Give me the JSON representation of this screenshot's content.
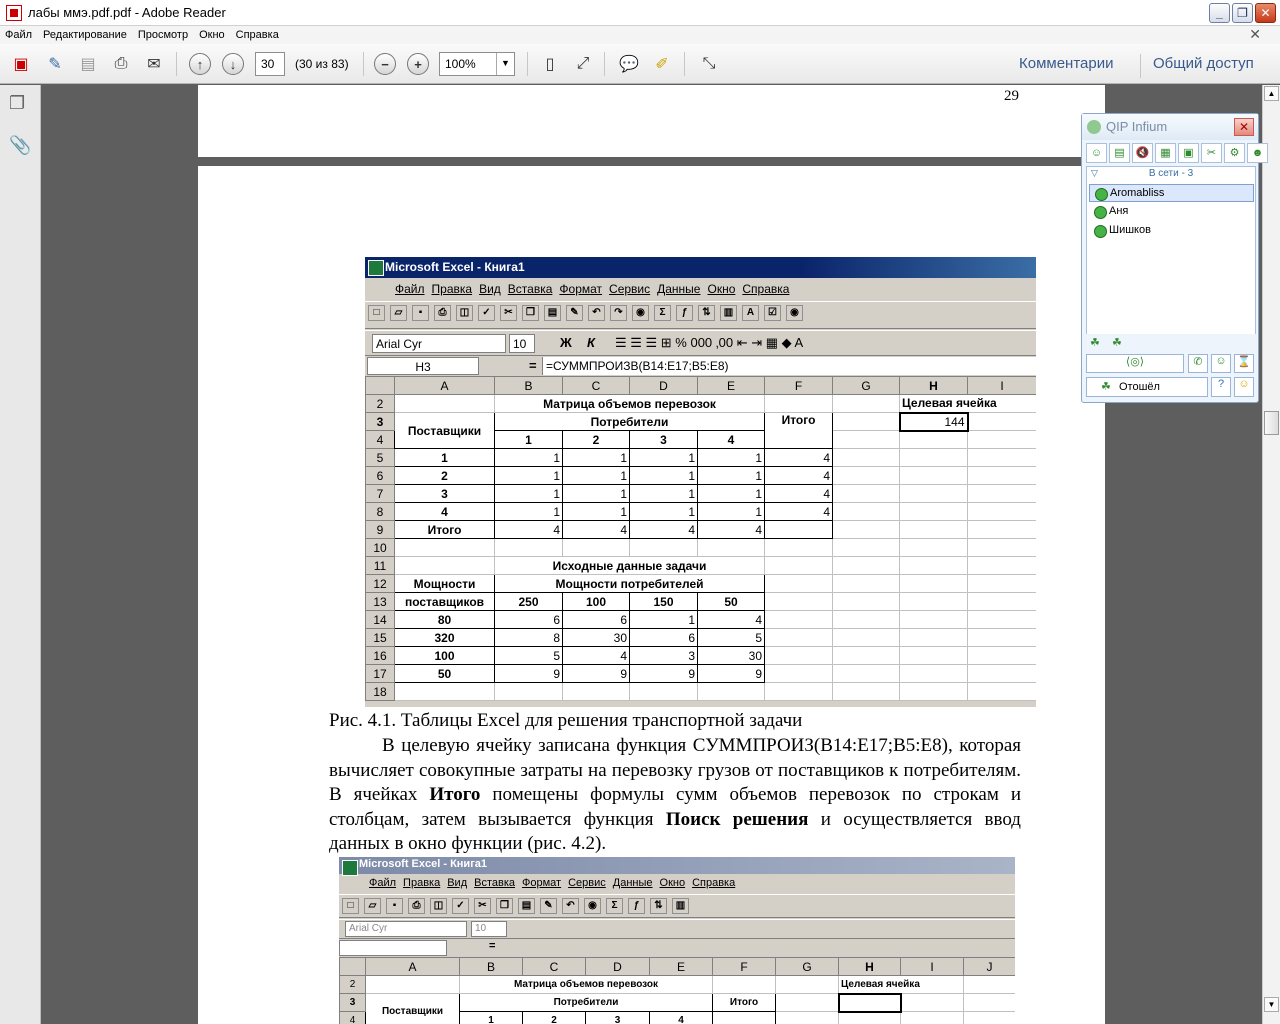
{
  "window": {
    "title": "лабы ммэ.pdf.pdf - Adobe Reader"
  },
  "menubar": [
    "Файл",
    "Редактирование",
    "Просмотр",
    "Окно",
    "Справка"
  ],
  "toolbar": {
    "page_value": "30",
    "page_count": "(30 из 83)",
    "zoom_value": "100%",
    "comments_label": "Комментарии",
    "share_label": "Общий доступ"
  },
  "document": {
    "page_number": "29",
    "caption": "Рис. 4.1. Таблицы Excel для решения транспортной задачи",
    "para": {
      "p1": "В целевую ячейку записана функция СУММПРОИЗ(B14:E17;B5:E8), которая вычисляет совокупные затраты на перевозку грузов от поставщиков к потребителям.  В ячейках ",
      "b1": "Итого",
      "p2": " помещены формулы сумм объемов перевозок по строкам и столбцам, затем вызывается функция ",
      "b2": "Поиск решения",
      "p3": " и осуществляется ввод данных в окно функции (рис. 4.2)."
    }
  },
  "excel1": {
    "title": "Microsoft Excel - Книга1",
    "menu": [
      "Файл",
      "Правка",
      "Вид",
      "Вставка",
      "Формат",
      "Сервис",
      "Данные",
      "Окно",
      "Справка"
    ],
    "font": "Arial Cyr",
    "size": "10",
    "cell_ref": "H3",
    "formula": "=СУММПРОИЗВ(B14:E17;B5:E8)",
    "cols": [
      "A",
      "B",
      "C",
      "D",
      "E",
      "F",
      "G",
      "H",
      "I"
    ],
    "rows": [
      "2",
      "3",
      "4",
      "5",
      "6",
      "7",
      "8",
      "9",
      "10",
      "11",
      "12",
      "13",
      "14",
      "15",
      "16",
      "17",
      "18"
    ],
    "t1_title": "Матрица объемов перевозок",
    "target_label": "Целевая ячейка",
    "target_value": "144",
    "suppliers": "Поставщики",
    "consumers": "Потребители",
    "total": "Итого",
    "consumer_nums": [
      "1",
      "2",
      "3",
      "4"
    ],
    "matrix": [
      {
        "s": "1",
        "v": [
          "1",
          "1",
          "1",
          "1"
        ],
        "t": "4"
      },
      {
        "s": "2",
        "v": [
          "1",
          "1",
          "1",
          "1"
        ],
        "t": "4"
      },
      {
        "s": "3",
        "v": [
          "1",
          "1",
          "1",
          "1"
        ],
        "t": "4"
      },
      {
        "s": "4",
        "v": [
          "1",
          "1",
          "1",
          "1"
        ],
        "t": "4"
      }
    ],
    "col_totals": [
      "4",
      "4",
      "4",
      "4"
    ],
    "t2_title": "Исходные данные задачи",
    "cap_sup_1": "Мощности",
    "cap_sup_2": "поставщиков",
    "cap_cons": "Мощности потребителей",
    "cons_caps": [
      "250",
      "100",
      "150",
      "50"
    ],
    "costs": [
      {
        "s": "80",
        "v": [
          "6",
          "6",
          "1",
          "4"
        ]
      },
      {
        "s": "320",
        "v": [
          "8",
          "30",
          "6",
          "5"
        ]
      },
      {
        "s": "100",
        "v": [
          "5",
          "4",
          "3",
          "30"
        ]
      },
      {
        "s": "50",
        "v": [
          "9",
          "9",
          "9",
          "9"
        ]
      }
    ]
  },
  "excel2": {
    "title": "Microsoft Excel - Книга1",
    "menu": [
      "Файл",
      "Правка",
      "Вид",
      "Вставка",
      "Формат",
      "Сервис",
      "Данные",
      "Окно",
      "Справка"
    ],
    "font": "Arial Cyr",
    "size": "10",
    "cols": [
      "A",
      "B",
      "C",
      "D",
      "E",
      "F",
      "G",
      "H",
      "I",
      "J"
    ],
    "t1_title": "Матрица объемов перевозок",
    "target_label": "Целевая ячейка",
    "suppliers": "Поставщики",
    "consumers": "Потребители",
    "total": "Итого",
    "consumer_nums": [
      "1",
      "2",
      "3",
      "4"
    ],
    "rows": [
      "2",
      "3",
      "4"
    ]
  },
  "qip": {
    "title": "QIP Infium",
    "group": "В сети - 3",
    "contacts": [
      "Aromabliss",
      "Аня",
      "Шишков"
    ],
    "status": "Отошёл"
  }
}
